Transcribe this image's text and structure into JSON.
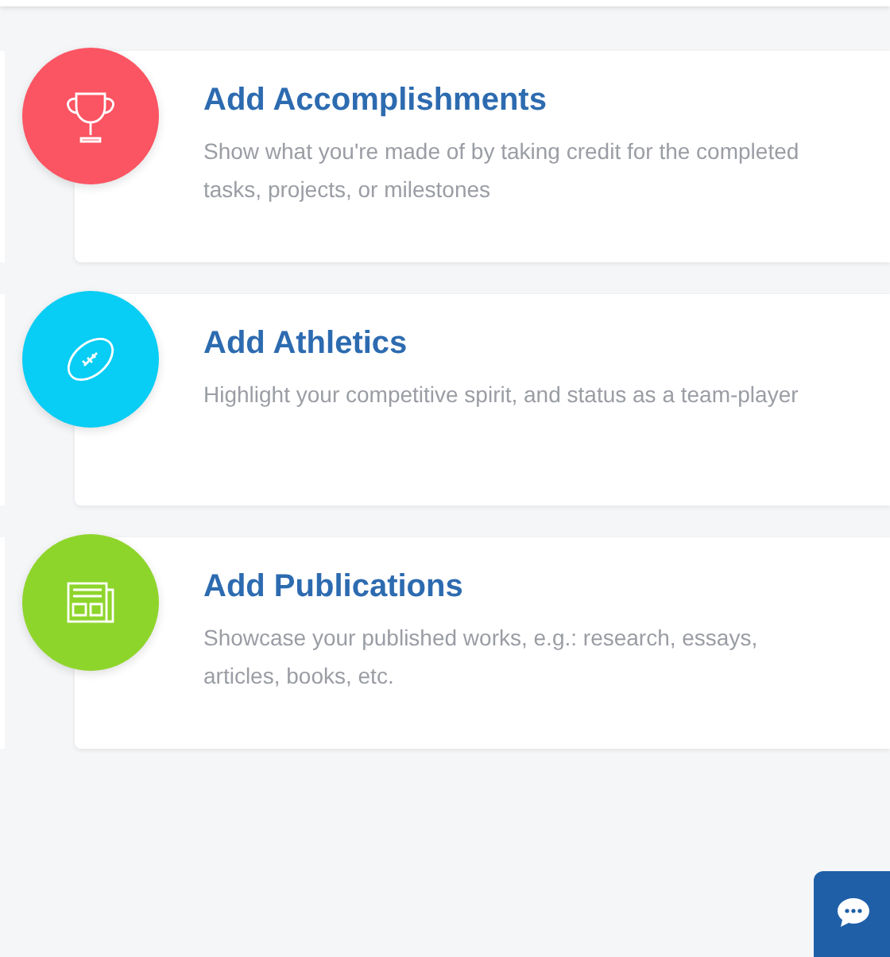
{
  "sections": [
    {
      "kind": "trophy",
      "color": "#fb5462",
      "title": "Add Accomplishments",
      "description": "Show what you're made of by taking credit for the completed tasks, projects, or milestones"
    },
    {
      "kind": "football",
      "color": "#08cdf4",
      "title": "Add Athletics",
      "description": "Highlight your competitive spirit, and status as a team-player"
    },
    {
      "kind": "newspaper",
      "color": "#8ed52b",
      "title": "Add Publications",
      "description": "Showcase your published works, e.g.: research, essays, articles, books, etc."
    }
  ]
}
